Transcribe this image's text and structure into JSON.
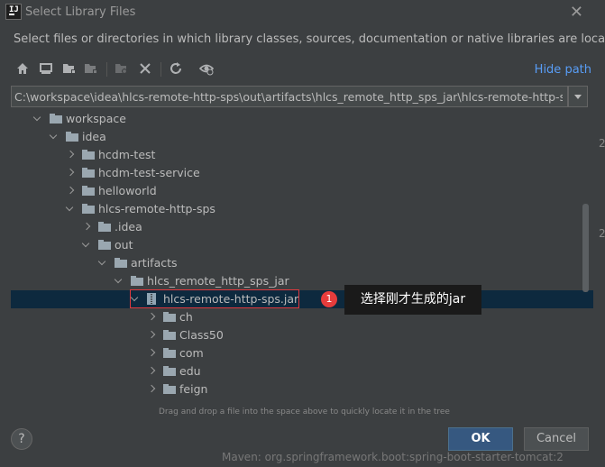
{
  "dialog": {
    "title": "Select Library Files",
    "description": "Select files or directories in which library classes, sources, documentation or native libraries are located"
  },
  "toolbar": {
    "hide_path_label": "Hide path",
    "icons": [
      "home-icon",
      "desktop-icon",
      "project-folder-icon",
      "module-folder-icon",
      "new-folder-icon",
      "delete-icon",
      "refresh-icon",
      "show-hidden-icon"
    ]
  },
  "path": {
    "value": "C:\\workspace\\idea\\hlcs-remote-http-sps\\out\\artifacts\\hlcs_remote_http_sps_jar\\hlcs-remote-http-sps.jar"
  },
  "tree": [
    {
      "label": "workspace",
      "expanded": true,
      "icon": "folder-icon"
    },
    {
      "label": "idea",
      "expanded": true,
      "icon": "folder-icon"
    },
    {
      "label": "hcdm-test",
      "expanded": false,
      "icon": "folder-icon"
    },
    {
      "label": "hcdm-test-service",
      "expanded": false,
      "icon": "folder-icon"
    },
    {
      "label": "helloworld",
      "expanded": false,
      "icon": "folder-icon"
    },
    {
      "label": "hlcs-remote-http-sps",
      "expanded": true,
      "icon": "folder-icon"
    },
    {
      "label": ".idea",
      "expanded": false,
      "icon": "folder-icon"
    },
    {
      "label": "out",
      "expanded": true,
      "icon": "folder-icon"
    },
    {
      "label": "artifacts",
      "expanded": true,
      "icon": "folder-icon"
    },
    {
      "label": "hlcs_remote_http_sps_jar",
      "expanded": true,
      "icon": "folder-icon"
    },
    {
      "label": "hlcs-remote-http-sps.jar",
      "expanded": true,
      "icon": "jar-icon",
      "selected": true
    },
    {
      "label": "ch",
      "expanded": false,
      "icon": "folder-icon"
    },
    {
      "label": "Class50",
      "expanded": false,
      "icon": "folder-icon"
    },
    {
      "label": "com",
      "expanded": false,
      "icon": "folder-icon"
    },
    {
      "label": "edu",
      "expanded": false,
      "icon": "folder-icon"
    },
    {
      "label": "feign",
      "expanded": false,
      "icon": "folder-icon"
    }
  ],
  "annotation": {
    "badge": "1",
    "text": "选择刚才生成的jar"
  },
  "hint": "Drag and drop a file into the space above to quickly locate it in the tree",
  "buttons": {
    "help": "?",
    "ok": "OK",
    "cancel": "Cancel"
  },
  "background_text": "Maven: org.springframework.boot:spring-boot-starter-tomcat:2",
  "colors": {
    "background": "#3c3f41",
    "selection": "#0d293e",
    "accent": "#589df6",
    "ok_button": "#365880",
    "annotation_red": "#e63c3c"
  }
}
